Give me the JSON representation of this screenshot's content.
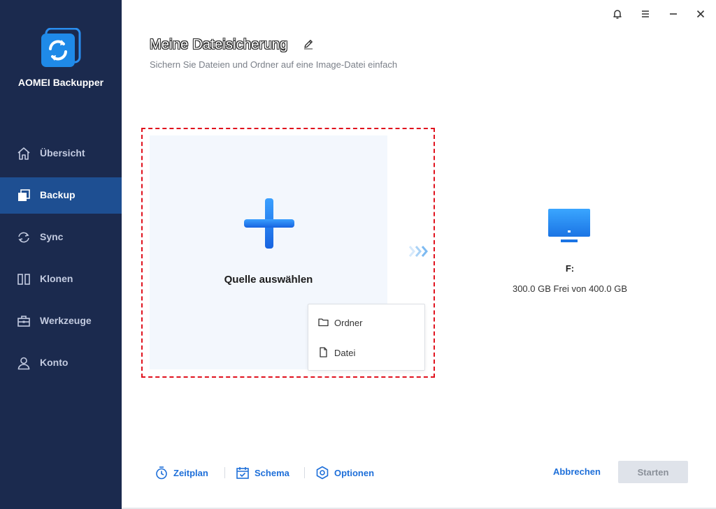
{
  "app": {
    "name": "AOMEI Backupper",
    "accent_color": "#1e6fd9",
    "sidebar_color": "#1b2a4e",
    "active_nav_color": "#1e4f92"
  },
  "sidebar": {
    "items": [
      {
        "label": "Übersicht",
        "icon": "home-icon"
      },
      {
        "label": "Backup",
        "icon": "backup-icon",
        "active": true
      },
      {
        "label": "Sync",
        "icon": "sync-icon"
      },
      {
        "label": "Klonen",
        "icon": "clone-icon"
      },
      {
        "label": "Werkzeuge",
        "icon": "toolbox-icon"
      },
      {
        "label": "Konto",
        "icon": "user-icon"
      }
    ]
  },
  "window_controls": [
    "bell-icon",
    "menu-icon",
    "minimize-icon",
    "close-icon"
  ],
  "header": {
    "title": "Meine Dateisicherung",
    "subtitle": "Sichern Sie Dateien und Ordner auf eine Image-Datei einfach"
  },
  "source": {
    "label": "Quelle auswählen",
    "highlight_color": "#e0111d",
    "menu": [
      {
        "label": "Ordner",
        "icon": "folder-icon"
      },
      {
        "label": "Datei",
        "icon": "file-icon"
      }
    ]
  },
  "destination": {
    "drive": "F:",
    "space": "300.0 GB Frei von 400.0 GB"
  },
  "toolbar": {
    "schedule_label": "Zeitplan",
    "scheme_label": "Schema",
    "options_label": "Optionen",
    "cancel_label": "Abbrechen",
    "start_label": "Starten"
  }
}
